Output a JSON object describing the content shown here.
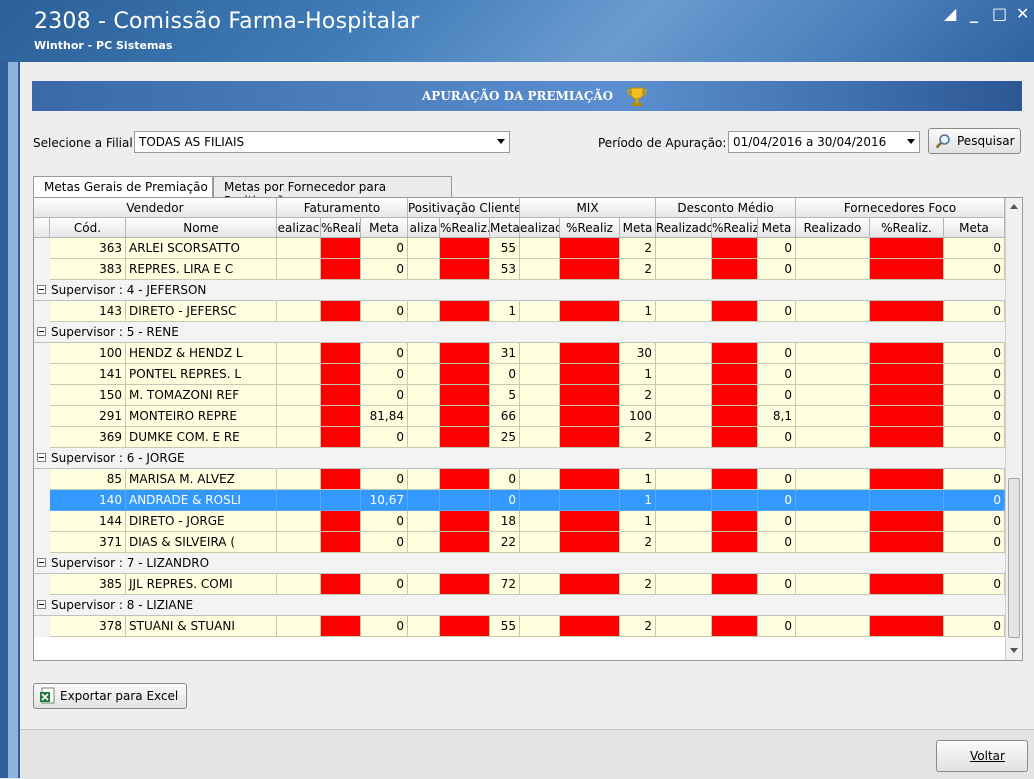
{
  "window": {
    "title": "2308 - Comissão Farma-Hospitalar",
    "subtitle": "Winthor - PC Sistemas",
    "controls": [
      "restore-icon",
      "minimize-icon",
      "maximize-icon",
      "close-icon"
    ]
  },
  "banner": {
    "title": "APURAÇÃO DA PREMIAÇÃO",
    "icon": "trophy-icon"
  },
  "filters": {
    "filial_label": "Selecione a Filial:",
    "filial_value": "TODAS AS FILIAIS",
    "periodo_label": "Período de Apuração:",
    "periodo_value": "01/04/2016 a 30/04/2016",
    "search_label": "Pesquisar"
  },
  "tabs": [
    {
      "label": "Metas Gerais de Premiação",
      "active": true
    },
    {
      "label": "Metas por Fornecedor para Positivação",
      "active": false
    }
  ],
  "grid": {
    "bands": [
      "Vendedor",
      "Faturamento",
      "Positivação Clientes",
      "MIX",
      "Desconto Médio",
      "Fornecedores Foco"
    ],
    "columns": [
      "Cód.",
      "Nome",
      "Realizado",
      "%Realiz.",
      "Meta",
      "Realizado",
      "%Realiz.",
      "Meta",
      "Realizado",
      "%Realiz.",
      "Meta",
      "Realizado",
      "%Realiz.",
      "Meta",
      "Realizado",
      "%Realiz.",
      "Meta"
    ],
    "column_labels_visible": [
      "Cód.",
      "Nome",
      "ealizac",
      "%Realiz",
      "Meta",
      "aliza",
      "%Realiz.",
      "Meta",
      "ealizac",
      "%Realiz",
      "Meta",
      "Realizado",
      "%Realiz",
      "Meta",
      "Realizado",
      "%Realiz.",
      "Meta"
    ],
    "rows": [
      {
        "type": "data",
        "cod": "363",
        "nome": "ARLEI SCORSATTO",
        "fat_meta": "0",
        "pos_meta": "55",
        "mix_meta": "2",
        "desc_meta": "0",
        "forn_meta": "0"
      },
      {
        "type": "data",
        "cod": "383",
        "nome": "REPRES. LIRA E C",
        "fat_meta": "0",
        "pos_meta": "53",
        "mix_meta": "2",
        "desc_meta": "0",
        "forn_meta": "0"
      },
      {
        "type": "group",
        "label": "Supervisor : 4 - JEFERSON"
      },
      {
        "type": "data",
        "cod": "143",
        "nome": "DIRETO - JEFERSC",
        "fat_meta": "0",
        "pos_meta": "1",
        "mix_meta": "1",
        "desc_meta": "0",
        "forn_meta": "0"
      },
      {
        "type": "group",
        "label": "Supervisor : 5 - RENE"
      },
      {
        "type": "data",
        "cod": "100",
        "nome": "HENDZ & HENDZ L",
        "fat_meta": "0",
        "pos_meta": "31",
        "mix_meta": "30",
        "desc_meta": "0",
        "forn_meta": "0"
      },
      {
        "type": "data",
        "cod": "141",
        "nome": "PONTEL REPRES. L",
        "fat_meta": "0",
        "pos_meta": "0",
        "mix_meta": "1",
        "desc_meta": "0",
        "forn_meta": "0"
      },
      {
        "type": "data",
        "cod": "150",
        "nome": "M. TOMAZONI REF",
        "fat_meta": "0",
        "pos_meta": "5",
        "mix_meta": "2",
        "desc_meta": "0",
        "forn_meta": "0"
      },
      {
        "type": "data",
        "cod": "291",
        "nome": "MONTEIRO REPRE",
        "fat_meta": "81,84",
        "pos_meta": "66",
        "mix_meta": "100",
        "desc_meta": "8,1",
        "forn_meta": "0"
      },
      {
        "type": "data",
        "cod": "369",
        "nome": "DUMKE COM. E RE",
        "fat_meta": "0",
        "pos_meta": "25",
        "mix_meta": "2",
        "desc_meta": "0",
        "forn_meta": "0"
      },
      {
        "type": "group",
        "label": "Supervisor : 6 - JORGE"
      },
      {
        "type": "data",
        "cod": "85",
        "nome": "MARISA M. ALVEZ",
        "fat_meta": "0",
        "pos_meta": "0",
        "mix_meta": "1",
        "desc_meta": "0",
        "forn_meta": "0"
      },
      {
        "type": "data",
        "cod": "140",
        "nome": "ANDRADE & ROSLI",
        "fat_meta": "10,67",
        "pos_meta": "0",
        "mix_meta": "1",
        "desc_meta": "0",
        "forn_meta": "0",
        "selected": true
      },
      {
        "type": "data",
        "cod": "144",
        "nome": "DIRETO - JORGE",
        "fat_meta": "0",
        "pos_meta": "18",
        "mix_meta": "1",
        "desc_meta": "0",
        "forn_meta": "0"
      },
      {
        "type": "data",
        "cod": "371",
        "nome": "DIAS & SILVEIRA (",
        "fat_meta": "0",
        "pos_meta": "22",
        "mix_meta": "2",
        "desc_meta": "0",
        "forn_meta": "0"
      },
      {
        "type": "group",
        "label": "Supervisor : 7 - LIZANDRO"
      },
      {
        "type": "data",
        "cod": "385",
        "nome": "JJL REPRES. COMI",
        "fat_meta": "0",
        "pos_meta": "72",
        "mix_meta": "2",
        "desc_meta": "0",
        "forn_meta": "0"
      },
      {
        "type": "group",
        "label": "Supervisor : 8 - LIZIANE"
      },
      {
        "type": "data",
        "cod": "378",
        "nome": "STUANI & STUANI",
        "fat_meta": "0",
        "pos_meta": "55",
        "mix_meta": "2",
        "desc_meta": "0",
        "forn_meta": "0"
      }
    ]
  },
  "actions": {
    "export_label": "Exportar para Excel",
    "back_label": "Voltar"
  },
  "colors": {
    "accent": "#3b69a8",
    "alert_cell": "#ff0000",
    "row_bg": "#ffffe0",
    "selected_row": "#3399ff"
  }
}
